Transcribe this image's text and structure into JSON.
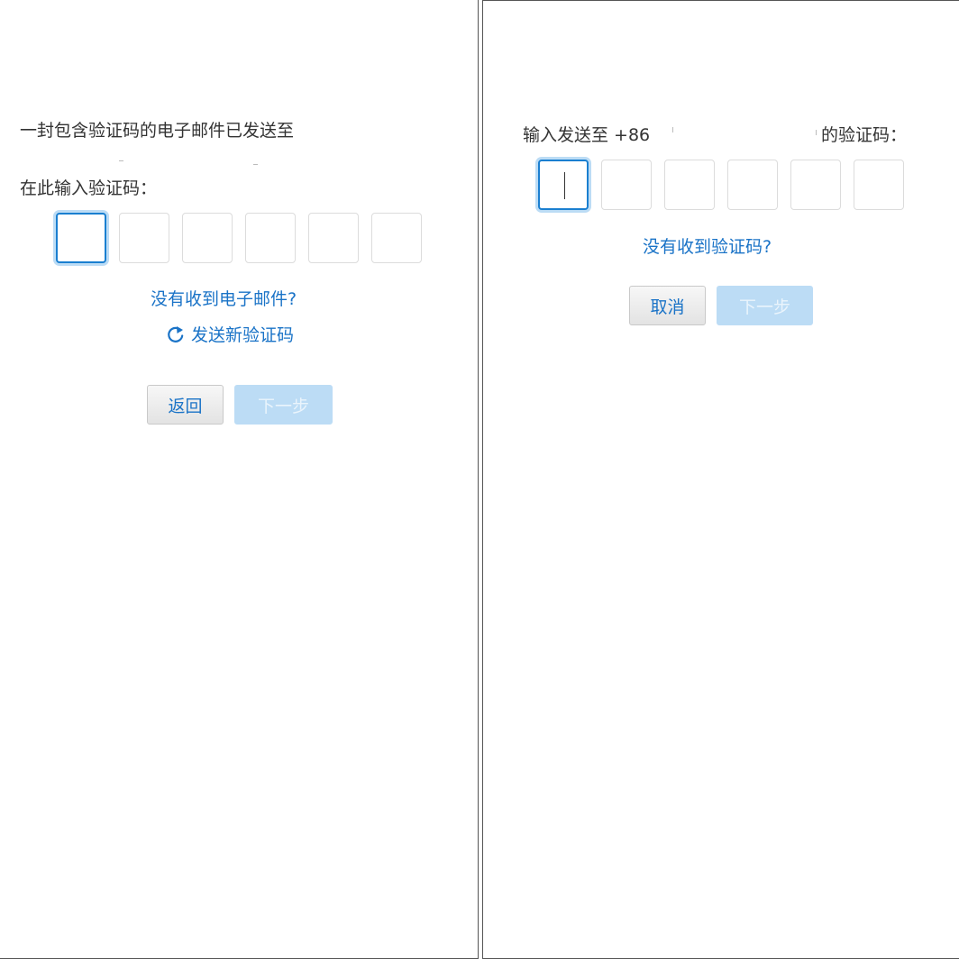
{
  "left_panel": {
    "sent_message": "一封包含验证码的电子邮件已发送至",
    "enter_code_label": "在此输入验证码：",
    "code_boxes": [
      "",
      "",
      "",
      "",
      "",
      ""
    ],
    "no_email_link": "没有收到电子邮件?",
    "resend_link": "发送新验证码",
    "resend_icon": "refresh-icon",
    "back_button": "返回",
    "next_button": "下一步"
  },
  "right_panel": {
    "prompt_prefix": "输入发送至 +86",
    "prompt_suffix": "的验证码：",
    "code_boxes": [
      "",
      "",
      "",
      "",
      "",
      ""
    ],
    "no_code_link": "没有收到验证码?",
    "cancel_button": "取消",
    "next_button": "下一步"
  },
  "colors": {
    "link": "#1a73c7",
    "active_border": "#1a7fd0",
    "disabled_button": "#bcdcf5"
  }
}
